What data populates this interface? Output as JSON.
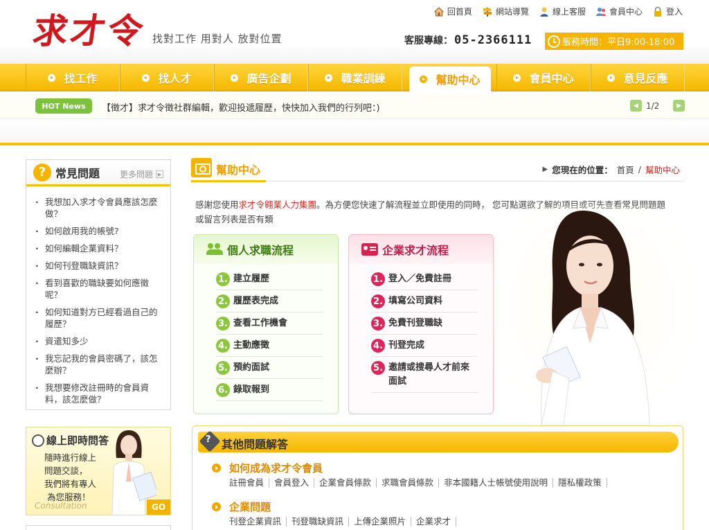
{
  "header": {
    "logo": "求才令",
    "slogan": "找對工作 用對人 放對位置",
    "service_label": "客服專線：",
    "service_phone": "05-2366111",
    "service_hours": "服務時間：平日9:00-18:00",
    "links": [
      {
        "label": "回首頁",
        "icon": "home-icon"
      },
      {
        "label": "網站導覽",
        "icon": "signpost-icon"
      },
      {
        "label": "線上客服",
        "icon": "support-agent-icon"
      },
      {
        "label": "會員中心",
        "icon": "member-icon"
      },
      {
        "label": "登入",
        "icon": "lock-icon"
      }
    ]
  },
  "nav": {
    "items": [
      {
        "label": "找工作",
        "active": false
      },
      {
        "label": "找人才",
        "active": false
      },
      {
        "label": "廣告企劃",
        "active": false
      },
      {
        "label": "職業訓練",
        "active": false
      },
      {
        "label": "幫助中心",
        "active": true
      },
      {
        "label": "會員中心",
        "active": false
      },
      {
        "label": "意見反應",
        "active": false
      }
    ]
  },
  "hotnews": {
    "badge": "HOT News",
    "text": "【徵才】求才令徵社群編輯，歡迎投遞履歷，快快加入我們的行列吧：)",
    "pager": "1/2"
  },
  "sidebar": {
    "faq_title": "常見問題",
    "faq_more": "更多問題",
    "faq_items": [
      "我想加入求才令會員應該怎麼做？",
      "如何啟用我的帳號?",
      "如何編輯企業資料？",
      "如何刊登職缺資訊？",
      "看到喜歡的職缺要如何應徵呢？",
      "如何知道對方已經看過自己的履歷？",
      "資遣知多少",
      "我忘記我的會員密碼了，該怎麼辦？",
      "我想要修改註冊時的會員資料，該怎麼做？"
    ],
    "live_title": "線上即時問答",
    "live_lines": [
      "隨時進行線上",
      "問題交談，",
      "我們將有專人",
      "為您服務！"
    ],
    "live_consult": "Consultation",
    "live_go": "GO"
  },
  "main": {
    "page_title": "幫助中心",
    "breadcrumb_label": "您現在的位置：",
    "breadcrumb_home": "首頁",
    "breadcrumb_sep": "/",
    "breadcrumb_current": "幫助中心",
    "intro_before": "感謝您使用",
    "intro_red": "求才令翱業人力集團",
    "intro_after": "。為方便您快速了解流程並立即使用的同時， 您可點選欲了解的項目或可先查看常見問題題或留言列表是否有類",
    "personal_flow": {
      "title": "個人求職流程",
      "steps": [
        "建立履歷",
        "履歷表完成",
        "查看工作機會",
        "主動應徵",
        "預約面試",
        "錄取報到"
      ]
    },
    "company_flow": {
      "title": "企業求才流程",
      "steps": [
        "登入／免費註冊",
        "填寫公司資料",
        "免費刊登職缺",
        "刊登完成",
        "邀請或搜尋人才前來面試"
      ]
    },
    "other": {
      "title": "其他問題解答",
      "categories": [
        {
          "title": "如何成為求才令會員",
          "links": [
            "註冊會員",
            "會員登入",
            "企業會員條款",
            "求職會員條款",
            "非本國籍人士帳號使用說明",
            "隱私權政策"
          ]
        },
        {
          "title": "企業問題",
          "links": [
            "刊登企業資訊",
            "刊登職缺資訊",
            "上傳企業照片",
            "企業求才"
          ]
        }
      ]
    }
  },
  "colors": {
    "brand_red": "#d0181f",
    "brand_yellow": "#f6b400",
    "green": "#8cc63f",
    "pink": "#e0235b"
  }
}
